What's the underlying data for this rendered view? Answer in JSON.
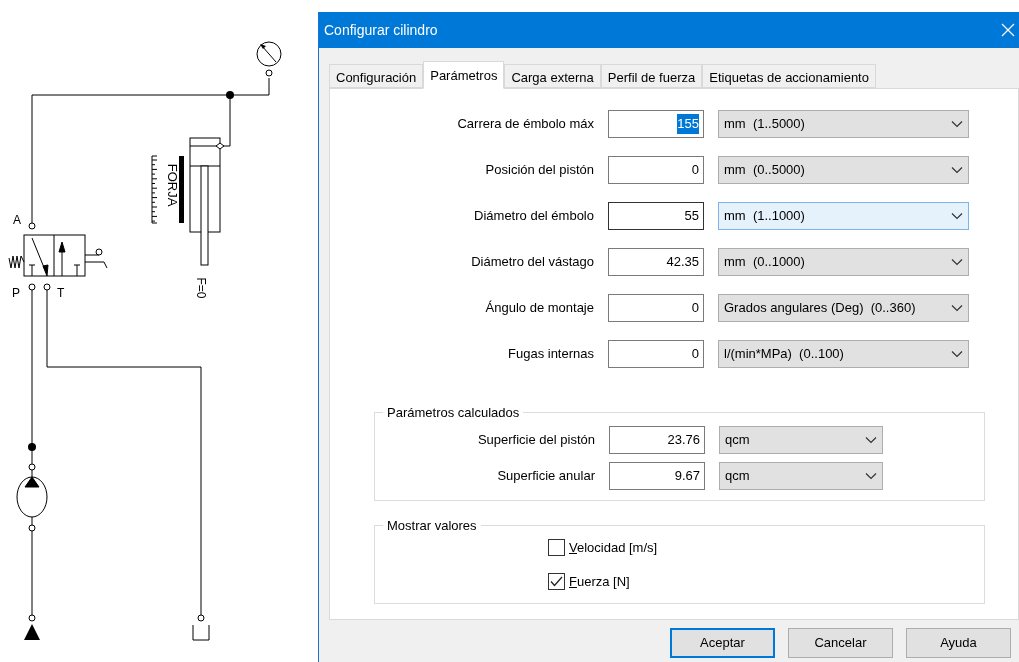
{
  "diagram": {
    "port_a": "A",
    "port_p": "P",
    "port_t": "T",
    "load_label": "FORJA",
    "force_label": "F=0"
  },
  "dialog": {
    "title": "Configurar cilindro",
    "tabs": [
      {
        "label": "Configuración",
        "selected": false
      },
      {
        "label": "Parámetros",
        "selected": true
      },
      {
        "label": "Carga externa",
        "selected": false
      },
      {
        "label": "Perfil de fuerza",
        "selected": false
      },
      {
        "label": "Etiquetas de accionamiento",
        "selected": false
      }
    ],
    "parameters": [
      {
        "label": "Carrera de émbolo máx",
        "value": "155",
        "unit": "mm  (1..5000)",
        "highlighted": true
      },
      {
        "label": "Posición del pistón",
        "value": "0",
        "unit": "mm  (0..5000)",
        "highlighted": false
      },
      {
        "label": "Diámetro del émbolo",
        "value": "55",
        "unit": "mm  (1..1000)",
        "highlighted": false
      },
      {
        "label": "Diámetro del vástago",
        "value": "42.35",
        "unit": "mm  (0..1000)",
        "highlighted": false
      },
      {
        "label": "Ángulo de montaje",
        "value": "0",
        "unit": "Grados angulares (Deg)  (0..360)",
        "highlighted": false
      },
      {
        "label": "Fugas internas",
        "value": "0",
        "unit": "l/(min*MPa)  (0..100)",
        "highlighted": false
      }
    ],
    "calculated": {
      "title": "Parámetros calculados",
      "rows": [
        {
          "label": "Superficie del pistón",
          "value": "23.76",
          "unit": "qcm"
        },
        {
          "label": "Superficie anular",
          "value": "9.67",
          "unit": "qcm"
        }
      ]
    },
    "display": {
      "title": "Mostrar valores",
      "options": [
        {
          "label": "Velocidad [m/s]",
          "checked": false
        },
        {
          "label": "Fuerza [N]",
          "checked": true
        }
      ]
    },
    "buttons": [
      "Aceptar",
      "Cancelar",
      "Ayuda"
    ]
  }
}
